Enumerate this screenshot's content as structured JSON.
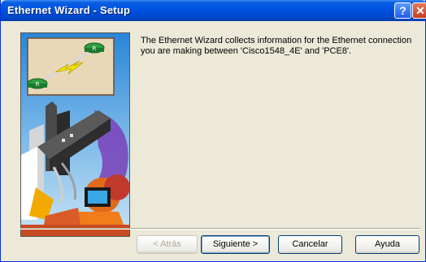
{
  "window": {
    "title": "Ethernet Wizard - Setup"
  },
  "titlebar": {
    "help_glyph": "?",
    "close_glyph": "✕"
  },
  "message": "The Ethernet Wizard collects information for the Ethernet connection you are making between 'Cisco1548_4E' and 'PCE8'.",
  "buttons": {
    "back": "< Atrás",
    "next": "Siguiente >",
    "cancel": "Cancelar",
    "help": "Ayuda"
  },
  "illustration": {
    "icon": "network-wizard-illustration",
    "router_labels": [
      "R",
      "R"
    ]
  },
  "colors": {
    "titlebar": "#0054e3",
    "dialog_bg": "#ece9d8",
    "close": "#c23e1c"
  }
}
